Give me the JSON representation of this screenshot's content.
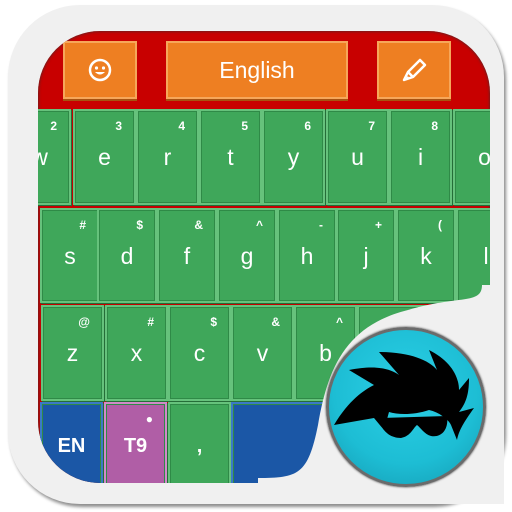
{
  "top_bar": {
    "emoji_icon": "smiley-icon",
    "language_label": "English",
    "pencil_icon": "pencil-icon"
  },
  "rows": [
    [
      {
        "main": "w",
        "sub": "2"
      },
      {
        "main": "e",
        "sub": "3"
      },
      {
        "main": "r",
        "sub": "4"
      },
      {
        "main": "t",
        "sub": "5"
      },
      {
        "main": "y",
        "sub": "6"
      },
      {
        "main": "u",
        "sub": "7"
      },
      {
        "main": "i",
        "sub": "8"
      },
      {
        "main": "o",
        "sub": ""
      }
    ],
    [
      {
        "main": "s",
        "sub": "#"
      },
      {
        "main": "d",
        "sub": "$"
      },
      {
        "main": "f",
        "sub": "&"
      },
      {
        "main": "g",
        "sub": "^"
      },
      {
        "main": "h",
        "sub": "-"
      },
      {
        "main": "j",
        "sub": "+"
      },
      {
        "main": "k",
        "sub": "("
      },
      {
        "main": "l",
        "sub": ""
      }
    ],
    [
      {
        "main": "z",
        "sub": "@"
      },
      {
        "main": "x",
        "sub": "#"
      },
      {
        "main": "c",
        "sub": "$"
      },
      {
        "main": "v",
        "sub": "&"
      },
      {
        "main": "b",
        "sub": "^"
      },
      {
        "main": "",
        "sub": ""
      },
      {
        "main": "",
        "sub": ""
      }
    ],
    [
      {
        "main": "EN",
        "sub": "",
        "color": "blue"
      },
      {
        "main": "T9",
        "sub": "●",
        "color": "purple"
      },
      {
        "main": ",",
        "sub": "",
        "color": "green"
      },
      {
        "main": "",
        "sub": "",
        "color": "blue"
      }
    ]
  ],
  "colors": {
    "top_bar": "#c80000",
    "key": "#3fa75a",
    "button": "#ee7f22",
    "lang_key": "#1b57a6",
    "t9_key": "#b05ea6",
    "logo": "#1dbdd4"
  },
  "logo_icon": "hair-sunglasses-character-icon"
}
